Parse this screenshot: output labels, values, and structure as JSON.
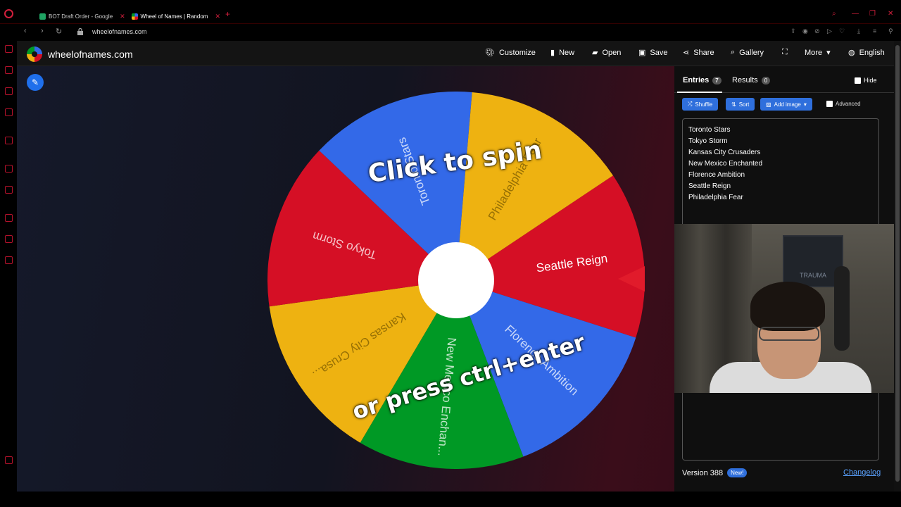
{
  "browser": {
    "tabs": [
      {
        "title": "BO7 Draft Order - Google",
        "color": "#1fa463"
      },
      {
        "title": "Wheel of Names | Random",
        "color": "#3369e8"
      }
    ],
    "url": "wheelofnames.com",
    "accent": "#d21f3c"
  },
  "app": {
    "site_name": "wheelofnames.com",
    "nav": {
      "customize": "Customize",
      "new": "New",
      "open": "Open",
      "save": "Save",
      "share": "Share",
      "gallery": "Gallery",
      "more": "More",
      "language": "English"
    },
    "wheel": {
      "segments": [
        {
          "label": "Seattle Reign",
          "color": "#d50f25"
        },
        {
          "label": "Florence Ambition",
          "color": "#3369e8"
        },
        {
          "label": "New Mexico Enchan...",
          "color": "#009925"
        },
        {
          "label": "Kansas City Crusa...",
          "color": "#eeb211"
        },
        {
          "label": "Tokyo Storm",
          "color": "#d50f25"
        },
        {
          "label": "Toronto Stars",
          "color": "#3369e8"
        },
        {
          "label": "Philadelphia Fear",
          "color": "#eeb211"
        }
      ],
      "spin_line_1": "Click to spin",
      "spin_line_2": "or press ctrl+enter",
      "pointer_color": "#e11b2b"
    },
    "panel": {
      "entries_tab": "Entries",
      "entries_count": "7",
      "results_tab": "Results",
      "results_count": "0",
      "hide_label": "Hide",
      "shuffle": "Shuffle",
      "sort": "Sort",
      "add_image": "Add image",
      "advanced": "Advanced",
      "entries": [
        "Toronto Stars",
        "Tokyo Storm",
        "Kansas City Crusaders",
        "New Mexico Enchanted",
        "Florence Ambition",
        "Seattle Reign",
        "Philadelphia Fear"
      ],
      "version": "Version 388",
      "new_badge": "New!",
      "changelog": "Changelog"
    },
    "webcam": {
      "poster_text": "TRAUMA"
    }
  }
}
